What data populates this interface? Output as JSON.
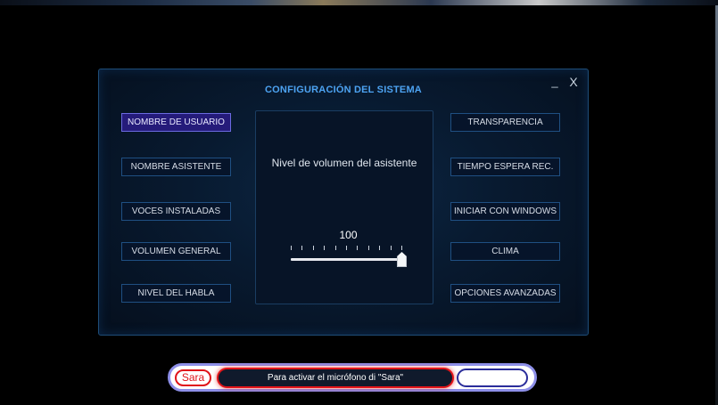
{
  "dialog": {
    "title": "CONFIGURACIÓN DEL SISTEMA",
    "minimize_label": "_",
    "close_label": "X"
  },
  "left_menu": [
    {
      "label": "NOMBRE DE USUARIO",
      "active": true
    },
    {
      "label": "NOMBRE ASISTENTE",
      "active": false
    },
    {
      "label": "VOCES INSTALADAS",
      "active": false
    },
    {
      "label": "VOLUMEN GENERAL",
      "active": false
    },
    {
      "label": "NIVEL DEL HABLA",
      "active": false
    }
  ],
  "right_menu": [
    {
      "label": "TRANSPARENCIA"
    },
    {
      "label": "TIEMPO ESPERA REC."
    },
    {
      "label": "INICIAR CON WINDOWS"
    },
    {
      "label": "CLIMA"
    },
    {
      "label": "OPCIONES AVANZADAS"
    }
  ],
  "volume_panel": {
    "label": "Nivel de volumen del asistente",
    "value": "100",
    "slider_min": 0,
    "slider_max": 100,
    "slider_value": 100
  },
  "voice_bar": {
    "assistant_name": "Sara",
    "status_text": "Para activar el micrófono di \"Sara\""
  },
  "colors": {
    "accent_blue": "#4da3f2",
    "active_button": "#251b7a",
    "alert_red": "#e0141a"
  }
}
